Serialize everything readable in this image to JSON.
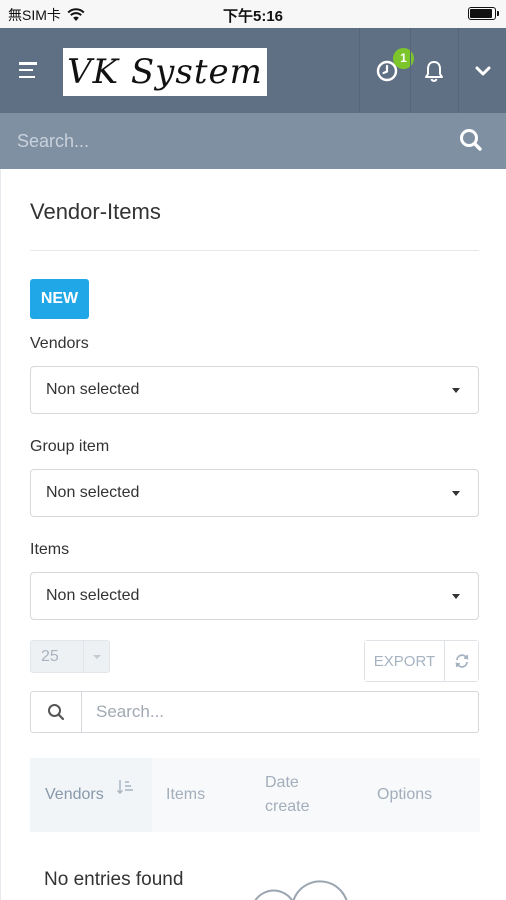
{
  "status_bar": {
    "carrier": "無SIM卡",
    "time": "下午5:16"
  },
  "header": {
    "logo_text": "VK System",
    "notification_count": "1"
  },
  "global_search": {
    "placeholder": "Search..."
  },
  "page": {
    "title": "Vendor-Items",
    "new_button": "NEW",
    "filters": [
      {
        "label": "Vendors",
        "value": "Non selected"
      },
      {
        "label": "Group item",
        "value": "Non selected"
      },
      {
        "label": "Items",
        "value": "Non selected"
      }
    ],
    "page_length": "25",
    "export_button": "EXPORT",
    "table_search_placeholder": "Search...",
    "columns": [
      "Vendors",
      "Items",
      "Date create",
      "Options"
    ],
    "empty_message": "No entries found"
  },
  "colors": {
    "navbar": "#5f6f84",
    "search_bar": "#8090a3",
    "primary_button": "#1fa7e8",
    "badge": "#7cc62c"
  }
}
